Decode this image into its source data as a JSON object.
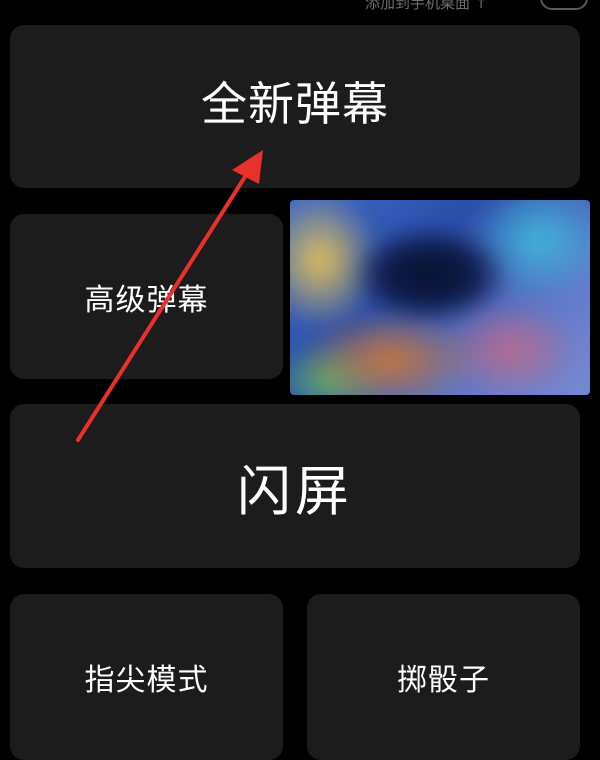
{
  "header": {
    "hint_text": "添加到手机桌面 ↑"
  },
  "tiles": {
    "new_barrage": "全新弹幕",
    "advanced_barrage": "高级弹幕",
    "flash_screen": "闪屏",
    "fingertip_mode": "指尖模式",
    "throw_dice": "掷骰子"
  },
  "annotation": {
    "arrow_color": "#e8302c"
  },
  "colors": {
    "background": "#000000",
    "tile": "#1c1c1c",
    "text": "#ffffff"
  }
}
